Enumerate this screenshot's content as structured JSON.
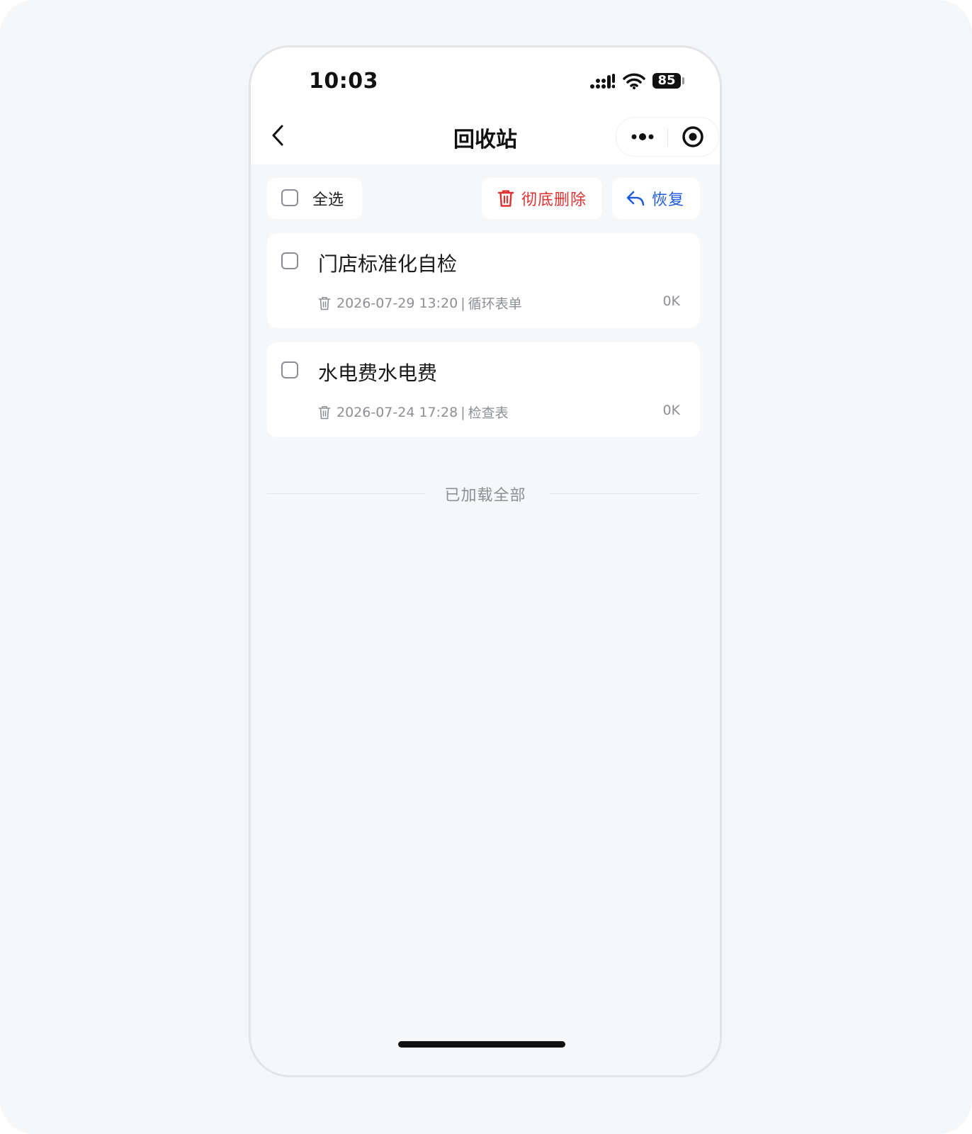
{
  "status_bar": {
    "time": "10:03",
    "battery": "85",
    "icons": [
      "signal-icon",
      "wifi-icon",
      "battery-icon"
    ]
  },
  "nav": {
    "title": "回收站",
    "back_icon": "chevron-left-icon",
    "more_icon": "more-dots-icon",
    "close_icon": "target-close-icon"
  },
  "toolbar": {
    "select_all_label": "全选",
    "delete_label": "彻底删除",
    "restore_label": "恢复"
  },
  "items": [
    {
      "title": "门店标准化自检",
      "deleted_at": "2026-07-29 13:20",
      "separator": "|",
      "type": "循环表单",
      "size": "0K"
    },
    {
      "title": "水电费水电费",
      "deleted_at": "2026-07-24 17:28",
      "separator": "|",
      "type": "检查表",
      "size": "0K"
    }
  ],
  "footer": {
    "text": "已加载全部"
  },
  "colors": {
    "danger": "#e03131",
    "primary": "#1f5bdc",
    "page_bg": "#f6f7f9",
    "muted_text": "#8c8f94"
  }
}
